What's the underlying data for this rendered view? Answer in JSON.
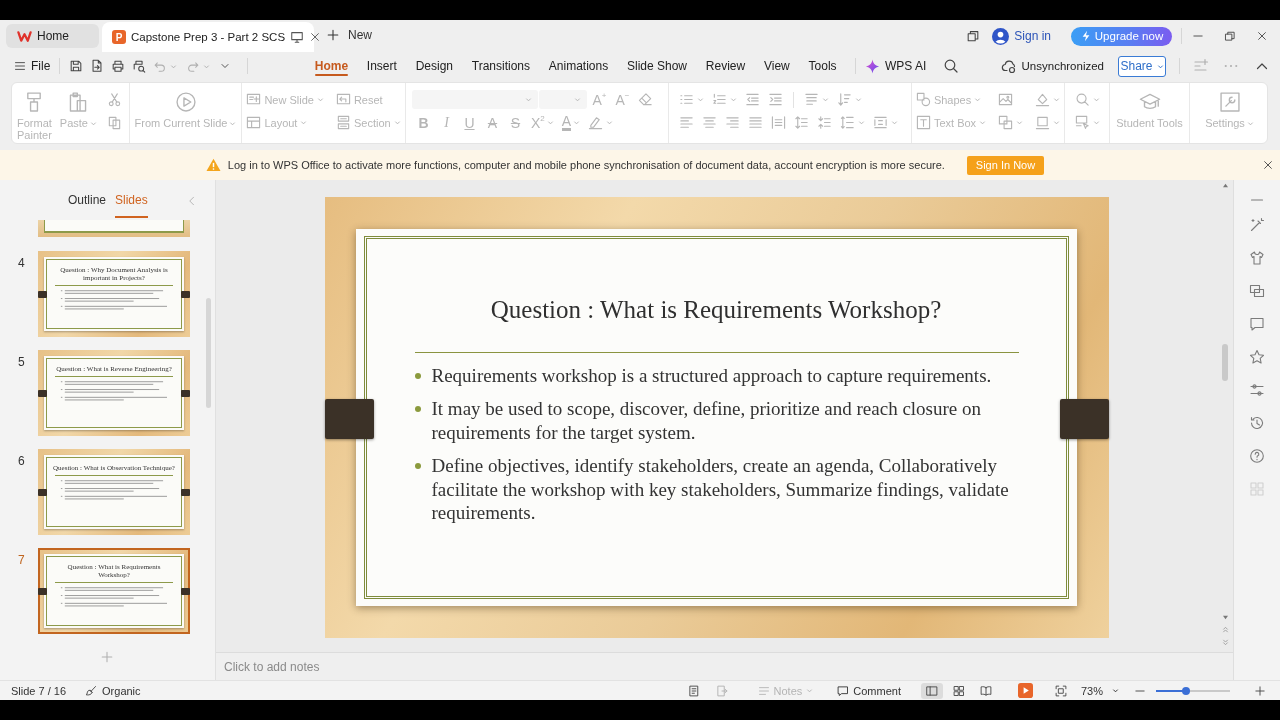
{
  "tab_bar": {
    "tabs": [
      {
        "kind": "home",
        "label": "Home",
        "selected": false
      },
      {
        "kind": "document",
        "badge": "P",
        "label": "Capstone Prep 3 - Part 2 SCS",
        "selected": true
      }
    ],
    "new_tab": "New",
    "sign_in": "Sign in",
    "upgrade": "Upgrade now"
  },
  "menu_bar": {
    "file": "File",
    "ribbon_tabs": [
      {
        "label": "Home",
        "selected": true
      },
      {
        "label": "Insert",
        "selected": false
      },
      {
        "label": "Design",
        "selected": false
      },
      {
        "label": "Transitions",
        "selected": false
      },
      {
        "label": "Animations",
        "selected": false
      },
      {
        "label": "Slide Show",
        "selected": false
      },
      {
        "label": "Review",
        "selected": false
      },
      {
        "label": "View",
        "selected": false
      },
      {
        "label": "Tools",
        "selected": false
      }
    ],
    "ai": "WPS AI",
    "sync_status": "Unsynchronized",
    "share": "Share"
  },
  "ribbon": {
    "groups": [
      {
        "kind": "columns",
        "columns": [
          {
            "kind": "large",
            "items": [
              {
                "kind": "button",
                "label": "Format Painter",
                "menu": false,
                "disabled": true
              }
            ]
          },
          {
            "kind": "large",
            "items": [
              {
                "kind": "button",
                "label": "Paste",
                "menu": true,
                "disabled": true
              }
            ]
          },
          {
            "kind": "stack",
            "items": [
              {
                "kind": "button",
                "menu": false,
                "disabled": true
              },
              {
                "kind": "button",
                "menu": false,
                "disabled": true
              }
            ]
          }
        ]
      },
      {
        "kind": "columns",
        "columns": [
          {
            "kind": "large",
            "items": [
              {
                "kind": "button",
                "label": "From Current Slide",
                "menu": true,
                "disabled": true
              }
            ]
          }
        ]
      },
      {
        "kind": "columns",
        "columns": [
          {
            "kind": "stack",
            "items": [
              {
                "kind": "button",
                "label": "New Slide",
                "menu": true,
                "disabled": true
              },
              {
                "kind": "button",
                "label": "Layout",
                "menu": true,
                "disabled": true
              }
            ]
          },
          {
            "kind": "stack",
            "items": [
              {
                "kind": "button",
                "label": "Reset",
                "menu": false,
                "disabled": true
              },
              {
                "kind": "button",
                "label": "Section",
                "menu": true,
                "disabled": true
              }
            ]
          }
        ]
      },
      {
        "kind": "rows",
        "rows": [
          [
            {
              "kind": "field",
              "menu": true,
              "disabled": true
            },
            {
              "kind": "field",
              "menu": true,
              "disabled": true
            },
            {
              "kind": "letter",
              "glyph": "A$^{+}$",
              "menu": false,
              "disabled": true
            },
            {
              "kind": "letter",
              "glyph": "A$^{−}$",
              "menu": false,
              "disabled": true
            },
            {
              "kind": "button",
              "menu": false,
              "disabled": true
            }
          ],
          [
            {
              "kind": "bold",
              "glyph": "B",
              "menu": false,
              "disabled": true
            },
            {
              "kind": "italic",
              "glyph": "I",
              "menu": false,
              "disabled": true
            },
            {
              "kind": "underline",
              "glyph": "U",
              "menu": false,
              "disabled": true
            },
            {
              "kind": "strikethrough",
              "glyph": "A",
              "menu": false,
              "disabled": true
            },
            {
              "kind": "strikethrough",
              "glyph": "S",
              "menu": false,
              "disabled": true
            },
            {
              "kind": "letter",
              "glyph": "X$^{2}$",
              "menu": true,
              "disabled": true
            },
            {
              "kind": "colorbar",
              "glyph": "A",
              "menu": true,
              "disabled": true
            },
            {
              "kind": "button",
              "menu": true,
              "disabled": true
            }
          ]
        ]
      },
      {
        "kind": "rows",
        "rows": [
          [
            {
              "kind": "button",
              "menu": true,
              "disabled": true
            },
            {
              "kind": "button",
              "menu": true,
              "disabled": true
            },
            {
              "kind": "button",
              "menu": false,
              "disabled": true
            },
            {
              "kind": "button",
              "menu": false,
              "disabled": true
            },
            {
              "kind": "button",
              "menu": true,
              "disabled": true
            },
            {
              "kind": "button",
              "menu": true,
              "disabled": true
            }
          ],
          [
            {
              "kind": "button",
              "menu": false,
              "disabled": true
            },
            {
              "kind": "button",
              "menu": false,
              "disabled": true
            },
            {
              "kind": "button",
              "menu": false,
              "disabled": true
            },
            {
              "kind": "button",
              "menu": false,
              "disabled": true
            },
            {
              "kind": "button",
              "menu": false,
              "disabled": true
            },
            {
              "kind": "button",
              "menu": false,
              "disabled": true
            },
            {
              "kind": "button",
              "menu": false,
              "disabled": true
            },
            {
              "kind": "button",
              "menu": true,
              "disabled": true
            },
            {
              "kind": "button",
              "menu": true,
              "disabled": true
            }
          ]
        ]
      },
      {
        "kind": "columns",
        "columns": [
          {
            "kind": "stack",
            "items": [
              {
                "kind": "button",
                "label": "Shapes",
                "menu": true,
                "disabled": true
              },
              {
                "kind": "button",
                "label": "Text Box",
                "menu": true,
                "disabled": true
              }
            ]
          },
          {
            "kind": "stack",
            "items": [
              {
                "kind": "button",
                "menu": false,
                "disabled": true
              },
              {
                "kind": "button",
                "menu": true,
                "disabled": true
              }
            ]
          },
          {
            "kind": "stack",
            "items": [
              {
                "kind": "button",
                "menu": true,
                "disabled": true
              },
              {
                "kind": "button",
                "menu": true,
                "disabled": true
              }
            ]
          }
        ]
      },
      {
        "kind": "columns",
        "columns": [
          {
            "kind": "stack",
            "items": [
              {
                "kind": "button",
                "menu": true,
                "disabled": true
              },
              {
                "kind": "button",
                "menu": true,
                "disabled": true
              }
            ]
          }
        ]
      },
      {
        "kind": "columns",
        "columns": [
          {
            "kind": "large",
            "items": [
              {
                "kind": "button",
                "label": "Student Tools",
                "menu": false,
                "disabled": true
              }
            ]
          }
        ]
      },
      {
        "kind": "columns",
        "columns": [
          {
            "kind": "large",
            "items": [
              {
                "kind": "button",
                "label": "Settings",
                "menu": true,
                "disabled": true
              }
            ]
          }
        ]
      }
    ]
  },
  "notice": {
    "message": "Log in to WPS Office to activate more functions, computer and mobile phone synchronisation of document data, account encryption is more secure.",
    "button": "Sign In Now"
  },
  "slide_panel": {
    "tabs": [
      {
        "label": "Outline",
        "selected": false
      },
      {
        "label": "Slides",
        "selected": true
      }
    ],
    "slides": [
      {
        "number": "4",
        "title": "Question : Why Document Analysis is important in Projects?",
        "selected": false
      },
      {
        "number": "5",
        "title": "Question : What is Reverse Engineering?",
        "selected": false
      },
      {
        "number": "6",
        "title": "Question : What is Observation Technique?",
        "selected": false
      },
      {
        "number": "7",
        "title": "Question : What is Requirements Workshop?",
        "selected": true
      }
    ]
  },
  "slide": {
    "title": "Question : What is Requirements Workshop?",
    "bullets": [
      "Requirements workshop is a structured approach to capture requirements.",
      "It may be used to scope, discover, define, prioritize and reach closure on requirements for the target system.",
      "Define objectives, identify stakeholders, create an agenda, Collaboratively facilitate the workshop with key stakeholders, Summarize findings, validate requirements."
    ]
  },
  "notes": {
    "placeholder": "Click to add notes"
  },
  "status_bar": {
    "slide_position": "Slide 7 / 16",
    "theme": "Organic",
    "notes": {
      "label": "Notes",
      "disabled": true
    },
    "comment": "Comment",
    "views": [
      {
        "selected": true
      },
      {
        "selected": false
      },
      {
        "selected": false
      }
    ],
    "zoom": "73%",
    "zoom_slider": {
      "level": 0.4
    }
  }
}
